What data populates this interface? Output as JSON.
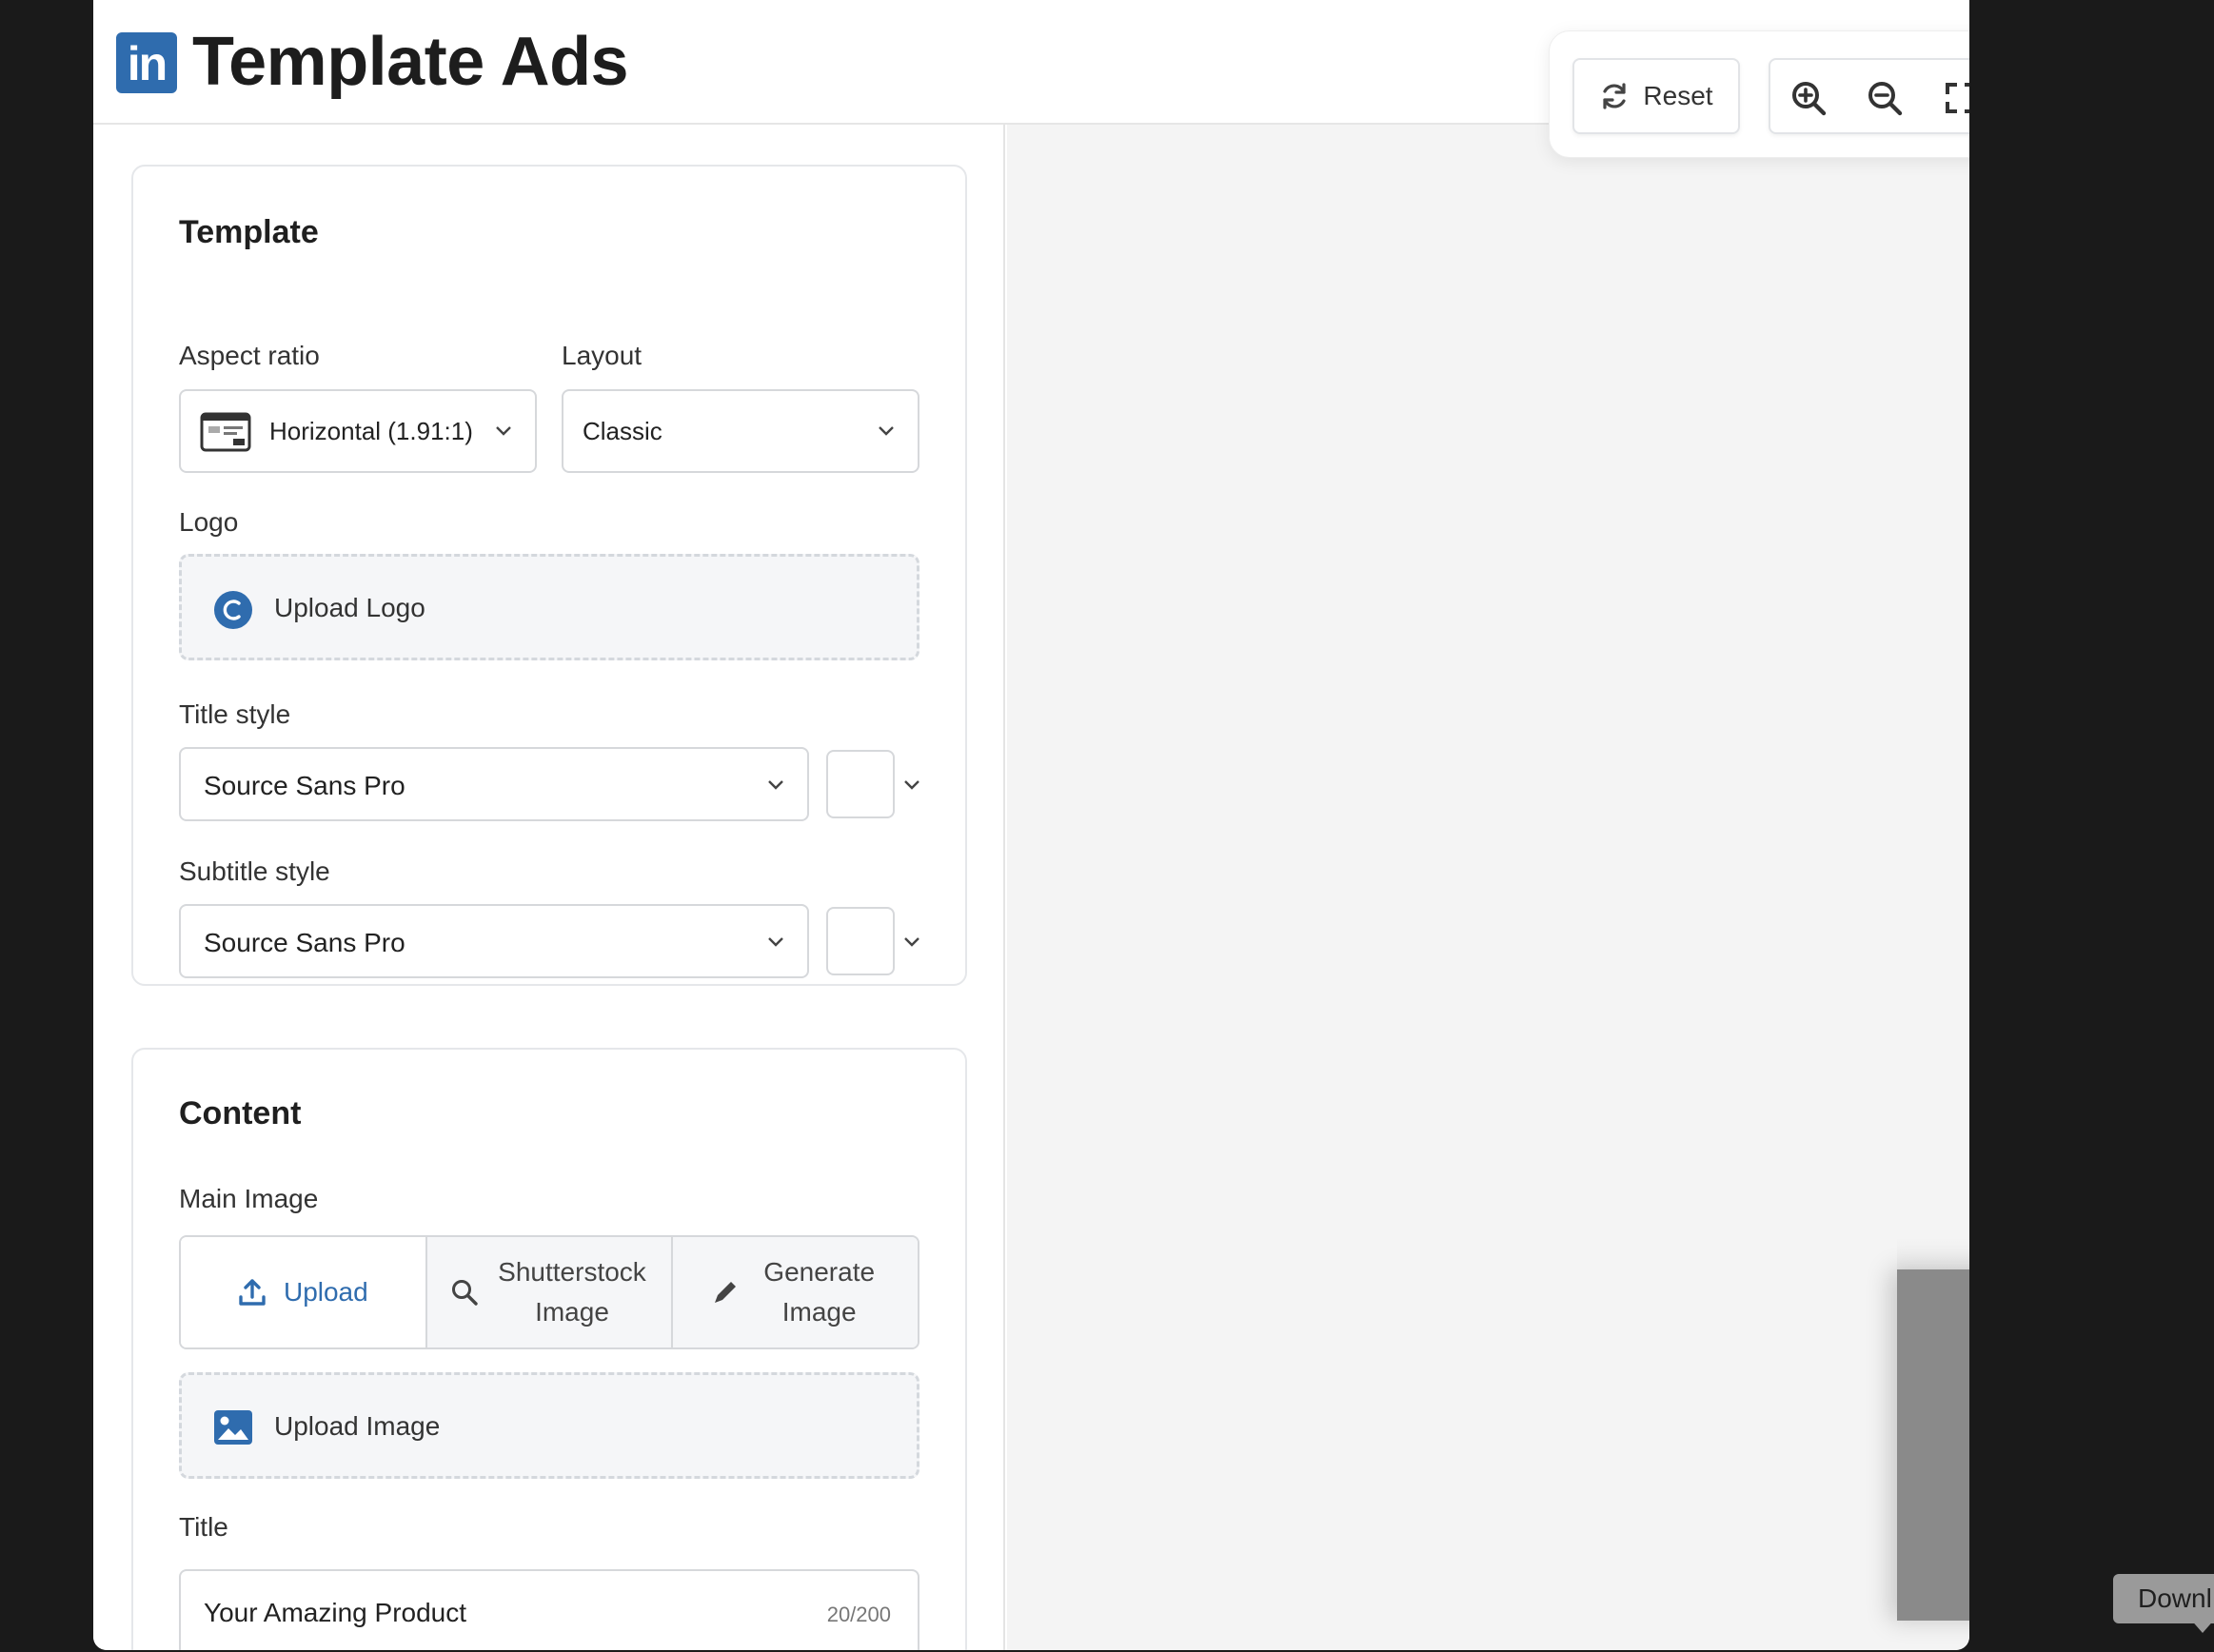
{
  "app": {
    "title": "Template Ads",
    "brand_icon": "linkedin-icon",
    "brand_text": "in"
  },
  "toolbar": {
    "reset_label": "Reset",
    "zoom_in_icon": "zoom-in-icon",
    "zoom_out_icon": "zoom-out-icon",
    "fullscreen_icon": "fullscreen-icon"
  },
  "template_section": {
    "heading": "Template",
    "aspect_ratio": {
      "label": "Aspect ratio",
      "value": "Horizontal (1.91:1)"
    },
    "layout": {
      "label": "Layout",
      "value": "Classic"
    },
    "logo": {
      "label": "Logo",
      "upload_label": "Upload Logo"
    },
    "title_style": {
      "label": "Title style",
      "font": "Source Sans Pro",
      "color": "#ffffff"
    },
    "subtitle_style": {
      "label": "Subtitle style",
      "font": "Source Sans Pro",
      "color": "#ffffff"
    }
  },
  "content_section": {
    "heading": "Content",
    "main_image": {
      "label": "Main Image",
      "tabs": [
        {
          "label": "Upload",
          "icon": "upload-icon",
          "active": true
        },
        {
          "label": "Shutterstock Image",
          "icon": "search-icon",
          "active": false
        },
        {
          "label": "Generate Image",
          "icon": "pencil-icon",
          "active": false
        }
      ],
      "upload_label": "Upload Image"
    },
    "title": {
      "label": "Title",
      "value": "Your Amazing Product",
      "counter": "20/200"
    }
  },
  "download_tooltip": "Downl",
  "colors": {
    "accent": "#2f6cae",
    "border": "#d6d8db",
    "preview_bg": "#f4f4f4"
  }
}
